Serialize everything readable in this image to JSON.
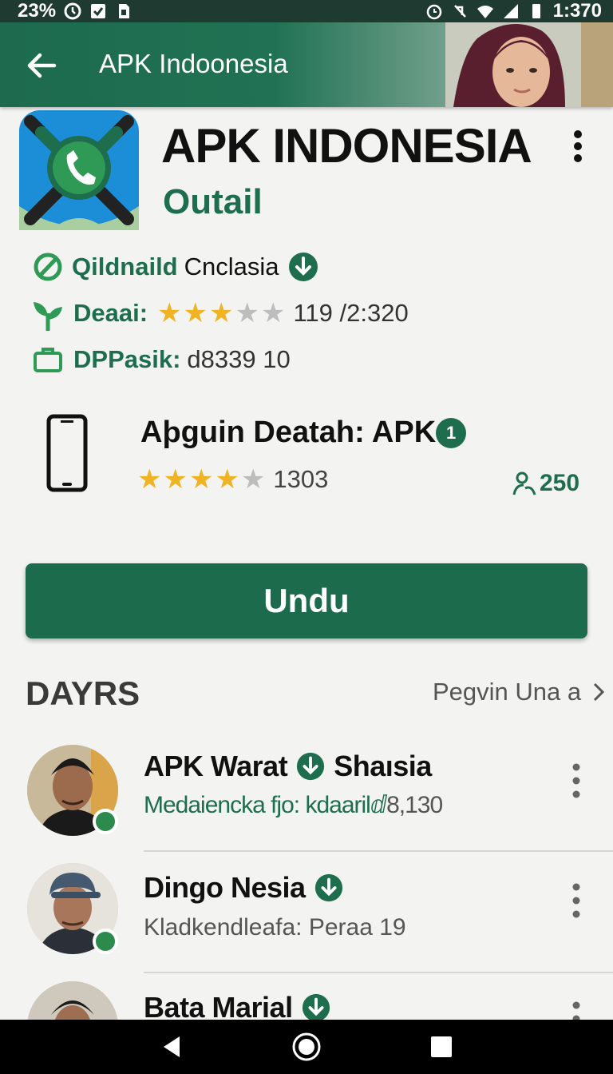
{
  "status_bar": {
    "battery": "23%",
    "time": "1:370"
  },
  "app_bar": {
    "title": "APK Indoonesia"
  },
  "app": {
    "name": "APK INDONESIA",
    "subtitle": "Outail",
    "developer_label": "Qildnaild",
    "developer_value": "Cnclasia",
    "rating_label": "Deaai:",
    "rating_stars": 3,
    "rating_max": 5,
    "rating_value": "119 /2:320",
    "size_label": "DPPasik:",
    "size_value": "d8339 10"
  },
  "device": {
    "title": "Aþguin Deatah: APK",
    "badge": "1",
    "stars": 4,
    "stars_max": 5,
    "rating_count": "1303",
    "count": "250"
  },
  "download_button": "Undu",
  "section": {
    "title": "DAYRS",
    "link": "Pegvin Una a"
  },
  "list": [
    {
      "title": "APK Warat",
      "title_after": "Shaısia",
      "subtitle": "Medaiencka fjo: kdaarilⅆ",
      "subtitle_num": "8,130",
      "sub_color": "#1e6e4d",
      "online": true
    },
    {
      "title": "Dingo Nesia",
      "title_after": "",
      "subtitle": "Kladkendleafa: Peraa 19",
      "subtitle_num": "",
      "sub_color": "#555555",
      "online": true
    },
    {
      "title": "Bata Marial",
      "title_after": "",
      "subtitle": "",
      "subtitle_num": "",
      "sub_color": "#555555",
      "online": false
    }
  ],
  "colors": {
    "accent": "#1e6e4d",
    "star": "#f0b323",
    "star_off": "#bdbdbd"
  }
}
